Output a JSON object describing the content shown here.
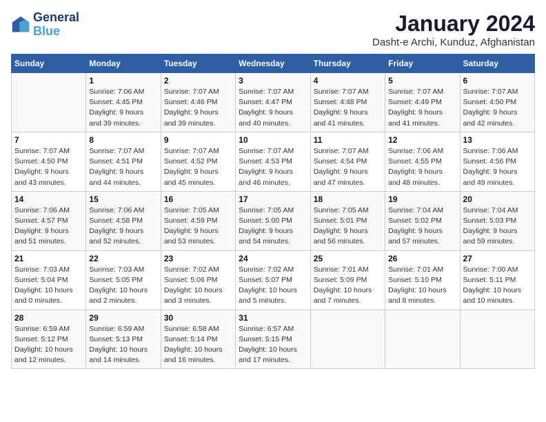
{
  "header": {
    "logo_line1": "General",
    "logo_line2": "Blue",
    "title": "January 2024",
    "subtitle": "Dasht-e Archi, Kunduz, Afghanistan"
  },
  "days_of_week": [
    "Sunday",
    "Monday",
    "Tuesday",
    "Wednesday",
    "Thursday",
    "Friday",
    "Saturday"
  ],
  "weeks": [
    [
      {
        "date": "",
        "info": ""
      },
      {
        "date": "1",
        "info": "Sunrise: 7:06 AM\nSunset: 4:45 PM\nDaylight: 9 hours\nand 39 minutes."
      },
      {
        "date": "2",
        "info": "Sunrise: 7:07 AM\nSunset: 4:46 PM\nDaylight: 9 hours\nand 39 minutes."
      },
      {
        "date": "3",
        "info": "Sunrise: 7:07 AM\nSunset: 4:47 PM\nDaylight: 9 hours\nand 40 minutes."
      },
      {
        "date": "4",
        "info": "Sunrise: 7:07 AM\nSunset: 4:48 PM\nDaylight: 9 hours\nand 41 minutes."
      },
      {
        "date": "5",
        "info": "Sunrise: 7:07 AM\nSunset: 4:49 PM\nDaylight: 9 hours\nand 41 minutes."
      },
      {
        "date": "6",
        "info": "Sunrise: 7:07 AM\nSunset: 4:50 PM\nDaylight: 9 hours\nand 42 minutes."
      }
    ],
    [
      {
        "date": "7",
        "info": "Sunrise: 7:07 AM\nSunset: 4:50 PM\nDaylight: 9 hours\nand 43 minutes."
      },
      {
        "date": "8",
        "info": "Sunrise: 7:07 AM\nSunset: 4:51 PM\nDaylight: 9 hours\nand 44 minutes."
      },
      {
        "date": "9",
        "info": "Sunrise: 7:07 AM\nSunset: 4:52 PM\nDaylight: 9 hours\nand 45 minutes."
      },
      {
        "date": "10",
        "info": "Sunrise: 7:07 AM\nSunset: 4:53 PM\nDaylight: 9 hours\nand 46 minutes."
      },
      {
        "date": "11",
        "info": "Sunrise: 7:07 AM\nSunset: 4:54 PM\nDaylight: 9 hours\nand 47 minutes."
      },
      {
        "date": "12",
        "info": "Sunrise: 7:06 AM\nSunset: 4:55 PM\nDaylight: 9 hours\nand 48 minutes."
      },
      {
        "date": "13",
        "info": "Sunrise: 7:06 AM\nSunset: 4:56 PM\nDaylight: 9 hours\nand 49 minutes."
      }
    ],
    [
      {
        "date": "14",
        "info": "Sunrise: 7:06 AM\nSunset: 4:57 PM\nDaylight: 9 hours\nand 51 minutes."
      },
      {
        "date": "15",
        "info": "Sunrise: 7:06 AM\nSunset: 4:58 PM\nDaylight: 9 hours\nand 52 minutes."
      },
      {
        "date": "16",
        "info": "Sunrise: 7:05 AM\nSunset: 4:59 PM\nDaylight: 9 hours\nand 53 minutes."
      },
      {
        "date": "17",
        "info": "Sunrise: 7:05 AM\nSunset: 5:00 PM\nDaylight: 9 hours\nand 54 minutes."
      },
      {
        "date": "18",
        "info": "Sunrise: 7:05 AM\nSunset: 5:01 PM\nDaylight: 9 hours\nand 56 minutes."
      },
      {
        "date": "19",
        "info": "Sunrise: 7:04 AM\nSunset: 5:02 PM\nDaylight: 9 hours\nand 57 minutes."
      },
      {
        "date": "20",
        "info": "Sunrise: 7:04 AM\nSunset: 5:03 PM\nDaylight: 9 hours\nand 59 minutes."
      }
    ],
    [
      {
        "date": "21",
        "info": "Sunrise: 7:03 AM\nSunset: 5:04 PM\nDaylight: 10 hours\nand 0 minutes."
      },
      {
        "date": "22",
        "info": "Sunrise: 7:03 AM\nSunset: 5:05 PM\nDaylight: 10 hours\nand 2 minutes."
      },
      {
        "date": "23",
        "info": "Sunrise: 7:02 AM\nSunset: 5:06 PM\nDaylight: 10 hours\nand 3 minutes."
      },
      {
        "date": "24",
        "info": "Sunrise: 7:02 AM\nSunset: 5:07 PM\nDaylight: 10 hours\nand 5 minutes."
      },
      {
        "date": "25",
        "info": "Sunrise: 7:01 AM\nSunset: 5:09 PM\nDaylight: 10 hours\nand 7 minutes."
      },
      {
        "date": "26",
        "info": "Sunrise: 7:01 AM\nSunset: 5:10 PM\nDaylight: 10 hours\nand 8 minutes."
      },
      {
        "date": "27",
        "info": "Sunrise: 7:00 AM\nSunset: 5:11 PM\nDaylight: 10 hours\nand 10 minutes."
      }
    ],
    [
      {
        "date": "28",
        "info": "Sunrise: 6:59 AM\nSunset: 5:12 PM\nDaylight: 10 hours\nand 12 minutes."
      },
      {
        "date": "29",
        "info": "Sunrise: 6:59 AM\nSunset: 5:13 PM\nDaylight: 10 hours\nand 14 minutes."
      },
      {
        "date": "30",
        "info": "Sunrise: 6:58 AM\nSunset: 5:14 PM\nDaylight: 10 hours\nand 16 minutes."
      },
      {
        "date": "31",
        "info": "Sunrise: 6:57 AM\nSunset: 5:15 PM\nDaylight: 10 hours\nand 17 minutes."
      },
      {
        "date": "",
        "info": ""
      },
      {
        "date": "",
        "info": ""
      },
      {
        "date": "",
        "info": ""
      }
    ]
  ]
}
